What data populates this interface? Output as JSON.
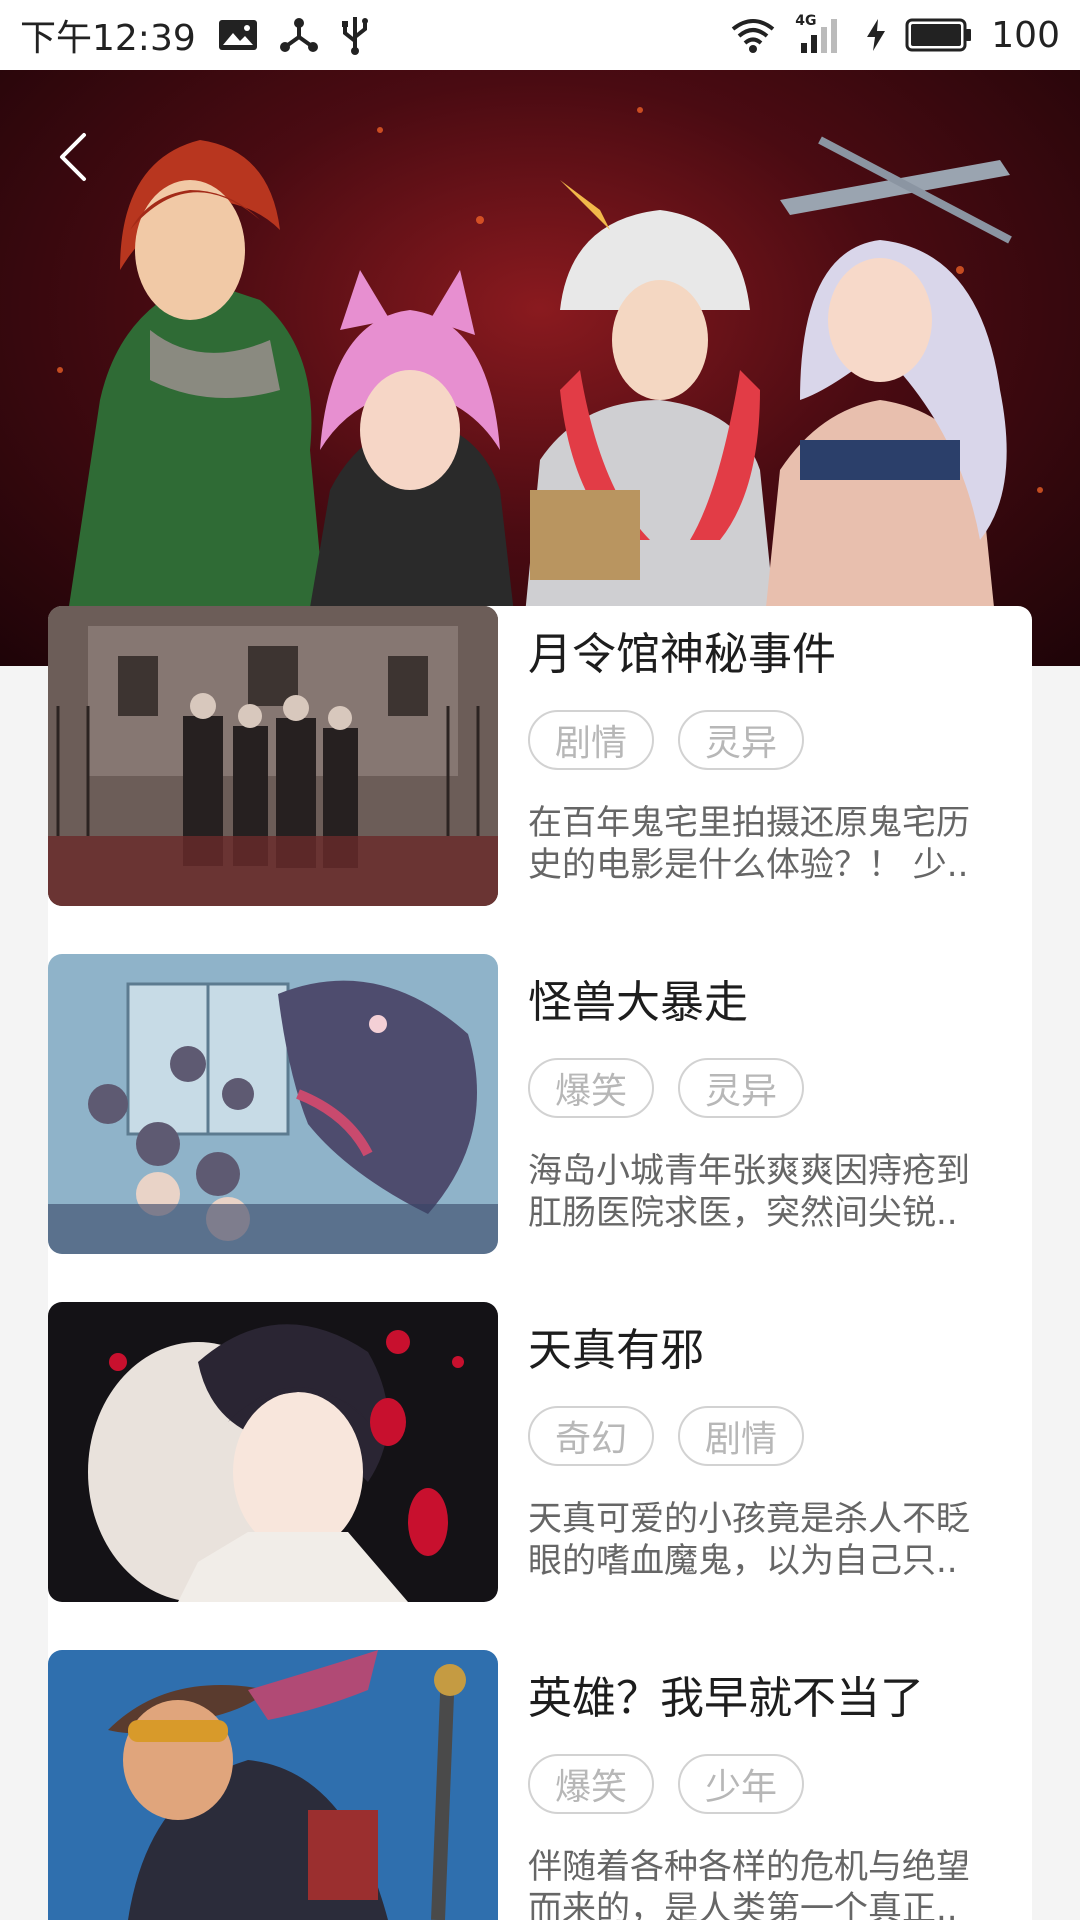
{
  "status_bar": {
    "time": "下午12:39",
    "battery": "100",
    "network": "4G",
    "icons": [
      "image-icon",
      "share-nodes-icon",
      "usb-icon",
      "wifi-icon",
      "signal-icon",
      "charging-icon",
      "battery-icon"
    ]
  },
  "banner": {
    "back_icon": "chevron-left-icon",
    "background_color": "#5a0d15"
  },
  "list": {
    "items": [
      {
        "title": "月令馆神秘事件",
        "tags": [
          "剧情",
          "灵异"
        ],
        "desc_line1": "在百年鬼宅里拍摄还原鬼宅历",
        "desc_line2": "史的电影是什么体验？！ 少.."
      },
      {
        "title": "怪兽大暴走",
        "tags": [
          "爆笑",
          "灵异"
        ],
        "desc_line1": "海岛小城青年张爽爽因痔疮到",
        "desc_line2": "肛肠医院求医，突然间尖锐.."
      },
      {
        "title": "天真有邪",
        "tags": [
          "奇幻",
          "剧情"
        ],
        "desc_line1": "天真可爱的小孩竟是杀人不眨",
        "desc_line2": "眼的嗜血魔鬼，以为自己只.."
      },
      {
        "title": "英雄？我早就不当了",
        "tags": [
          "爆笑",
          "少年"
        ],
        "desc_line1": "伴随着各种各样的危机与绝望",
        "desc_line2": "而来的，是人类第一个真正.."
      }
    ]
  },
  "colors": {
    "tag_border": "#d2d2d2",
    "tag_text": "#b7b7b7",
    "title_text": "#1d1d1d",
    "desc_text": "#666666"
  }
}
